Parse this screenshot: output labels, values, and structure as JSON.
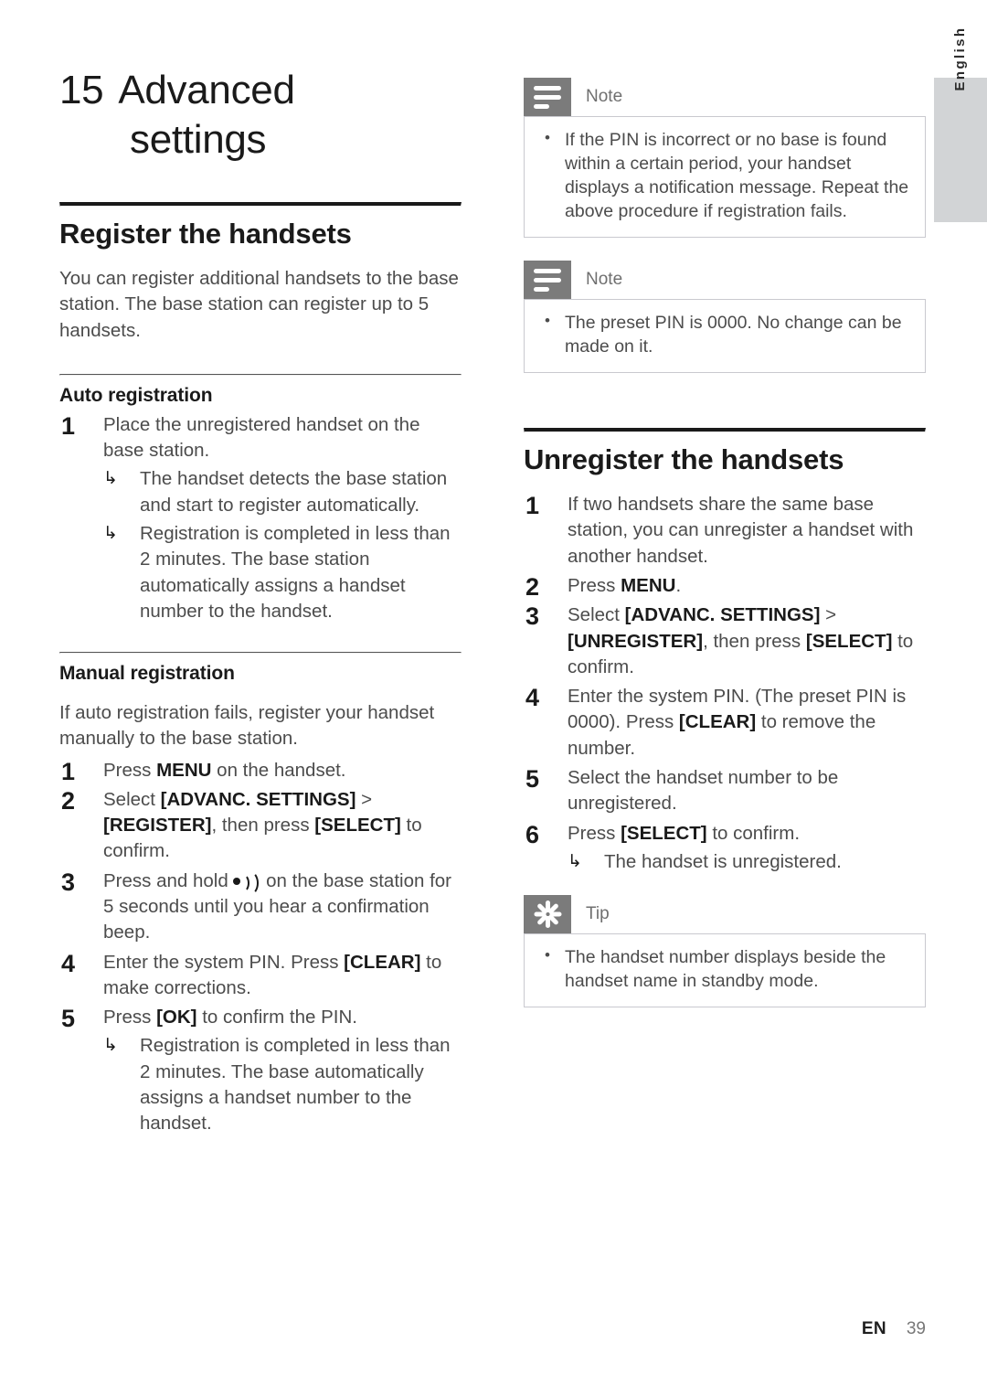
{
  "page": {
    "language_tab": "English",
    "footer": {
      "locale": "EN",
      "page_number": "39"
    }
  },
  "chapter": {
    "number": "15",
    "title_line1": "Advanced",
    "title_line2": "settings"
  },
  "left_column": {
    "section_heading": "Register the handsets",
    "intro": "You can register additional handsets to the base station. The base station can register up to 5 handsets.",
    "auto": {
      "heading": "Auto registration",
      "steps": [
        {
          "number": "1",
          "text": "Place the unregistered handset on the base station.",
          "results": [
            "The handset detects the base station and start to register automatically.",
            "Registration is completed in less than 2 minutes. The base station automatically assigns a handset number to the handset."
          ]
        }
      ]
    },
    "manual": {
      "heading": "Manual registration",
      "intro": "If auto registration fails, register your handset manually to the base station.",
      "steps": [
        {
          "number": "1",
          "prefix": "Press ",
          "bold": "MENU",
          "suffix": " on the handset."
        },
        {
          "number": "2",
          "prefix": "Select ",
          "bold1": "[ADVANC. SETTINGS]",
          "mid1": " > ",
          "bold2": "[REGISTER]",
          "mid2": ", then press ",
          "bold3": "[SELECT]",
          "suffix": " to confirm."
        },
        {
          "number": "3",
          "prefix": "Press and hold ",
          "icon": "paging-icon",
          "suffix": " on the base station for 5 seconds until you hear a confirmation beep."
        },
        {
          "number": "4",
          "prefix": "Enter the system PIN. Press ",
          "bold": "[CLEAR]",
          "suffix": " to make corrections."
        },
        {
          "number": "5",
          "prefix": "Press ",
          "bold": "[OK]",
          "suffix": " to confirm the PIN.",
          "results": [
            "Registration is completed in less than 2 minutes. The base automatically assigns a handset number to the handset."
          ]
        }
      ]
    }
  },
  "right_column": {
    "note1": {
      "label": "Note",
      "items": [
        "If the PIN is incorrect or no base is found within a certain period, your handset displays a notification message. Repeat the above procedure if registration fails."
      ]
    },
    "note2": {
      "label": "Note",
      "items": [
        "The preset PIN is 0000. No change can be made on it."
      ]
    },
    "unregister": {
      "heading": "Unregister the handsets",
      "steps": [
        {
          "number": "1",
          "text": "If two handsets share the same base station, you can unregister a handset with another handset."
        },
        {
          "number": "2",
          "prefix": "Press ",
          "bold": "MENU",
          "suffix": "."
        },
        {
          "number": "3",
          "prefix": "Select ",
          "bold1": "[ADVANC. SETTINGS]",
          "mid1": " > ",
          "bold2": "[UNREGISTER]",
          "mid2": ", then press ",
          "bold3": "[SELECT]",
          "suffix": " to confirm."
        },
        {
          "number": "4",
          "prefix": "Enter the system PIN. (The preset PIN is 0000). Press ",
          "bold": "[CLEAR]",
          "suffix": " to remove the number."
        },
        {
          "number": "5",
          "text": "Select the handset number to be unregistered."
        },
        {
          "number": "6",
          "prefix": "Press ",
          "bold": "[SELECT]",
          "suffix": " to confirm.",
          "results": [
            "The handset is unregistered."
          ]
        }
      ]
    },
    "tip": {
      "label": "Tip",
      "items": [
        "The handset number displays beside the handset name in standby mode."
      ]
    }
  },
  "glyphs": {
    "result_arrow": "↳",
    "bullet": "•"
  },
  "colors": {
    "badge_gray": "#7b7b7b",
    "tab_gray": "#d2d4d6",
    "body_text": "#4c4c4c",
    "heading_text": "#1a1a1a",
    "box_border": "#c9c9cf"
  }
}
